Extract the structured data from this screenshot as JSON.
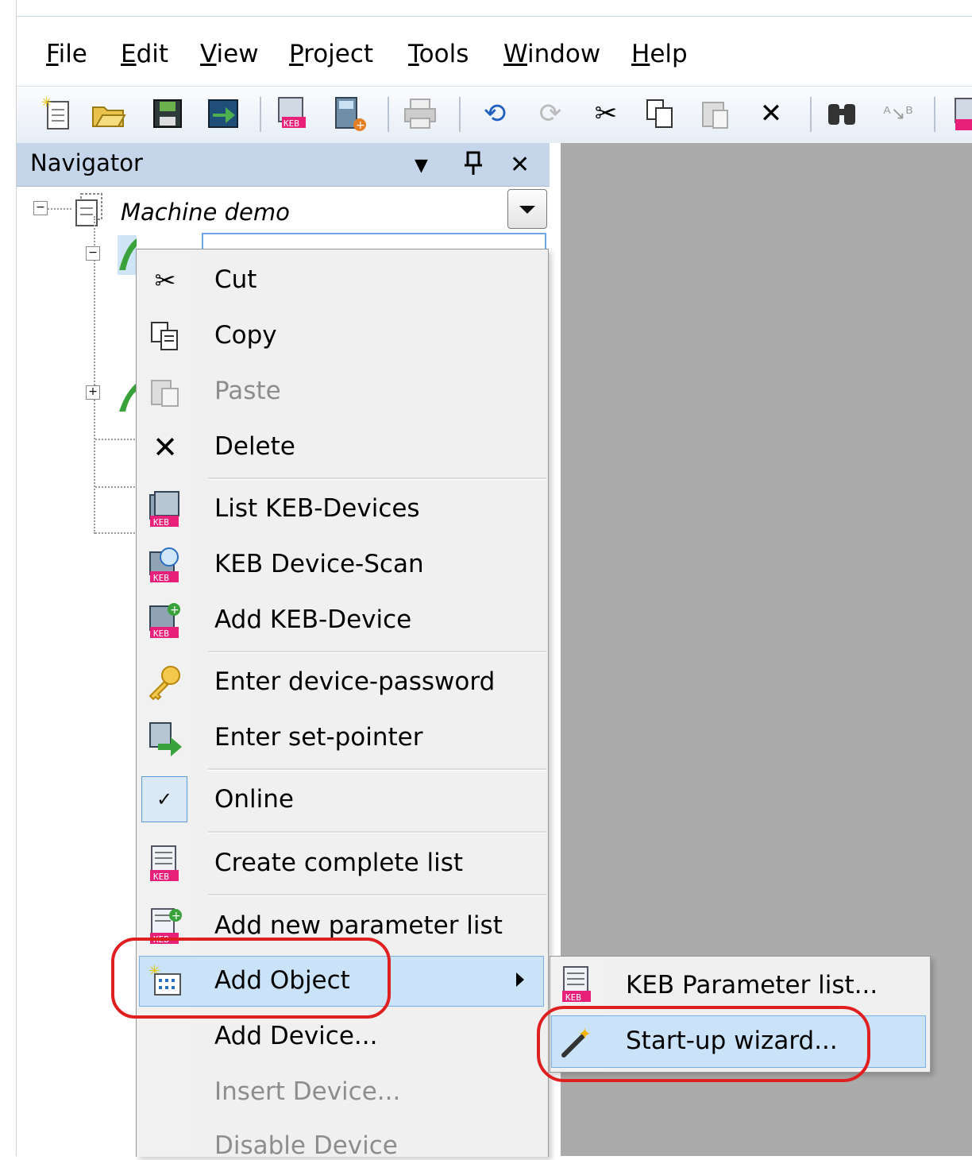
{
  "menubar": {
    "items": [
      {
        "label": "File",
        "u": "F"
      },
      {
        "label": "Edit",
        "u": "E"
      },
      {
        "label": "View",
        "u": "V"
      },
      {
        "label": "Project",
        "u": "P"
      },
      {
        "label": "Tools",
        "u": "T"
      },
      {
        "label": "Window",
        "u": "W"
      },
      {
        "label": "Help",
        "u": "H"
      }
    ]
  },
  "toolbar": {
    "icons": [
      "new-file-icon",
      "open-folder-icon",
      "save-icon",
      "import-icon",
      "keb-list-icon",
      "add-device-icon",
      "print-icon",
      "undo-icon",
      "redo-icon",
      "cut-icon",
      "copy-icon",
      "paste-icon",
      "delete-icon",
      "find-icon",
      "replace-icon",
      "keb-edit-icon"
    ]
  },
  "navigator": {
    "title": "Navigator",
    "buttons": {
      "dropdown": "▼",
      "pin": "个",
      "close": "✕"
    },
    "tree": {
      "root_label": "Machine demo"
    }
  },
  "context_menu": {
    "items": [
      {
        "label": "Cut",
        "icon": "scissors-icon",
        "disabled": false
      },
      {
        "label": "Copy",
        "icon": "copy-icon",
        "disabled": false
      },
      {
        "label": "Paste",
        "icon": "paste-icon",
        "disabled": true
      },
      {
        "label": "Delete",
        "icon": "delete-x-icon",
        "disabled": false
      },
      {
        "label": "List KEB-Devices",
        "icon": "keb-device-list-icon",
        "disabled": false
      },
      {
        "label": "KEB Device-Scan",
        "icon": "keb-scan-icon",
        "disabled": false
      },
      {
        "label": "Add KEB-Device",
        "icon": "keb-add-device-icon",
        "disabled": false
      },
      {
        "label": "Enter device-password",
        "icon": "key-icon",
        "disabled": false
      },
      {
        "label": "Enter set-pointer",
        "icon": "set-pointer-icon",
        "disabled": false
      },
      {
        "label": "Online",
        "icon": "check-icon",
        "disabled": false,
        "checked": true
      },
      {
        "label": "Create complete list",
        "icon": "keb-list-icon",
        "disabled": false
      },
      {
        "label": "Add new parameter list",
        "icon": "keb-add-list-icon",
        "disabled": false
      },
      {
        "label": "Add Object",
        "icon": "add-object-icon",
        "disabled": false,
        "highlighted": true,
        "has_submenu": true
      },
      {
        "label": "Add Device...",
        "icon": "",
        "disabled": false
      },
      {
        "label": "Insert Device...",
        "icon": "",
        "disabled": true
      },
      {
        "label": "Disable Device",
        "icon": "",
        "disabled": true
      }
    ]
  },
  "submenu": {
    "items": [
      {
        "label": "KEB Parameter list...",
        "icon": "keb-parameter-list-icon",
        "highlighted": false
      },
      {
        "label": "Start-up wizard...",
        "icon": "magic-wand-icon",
        "highlighted": true
      }
    ]
  },
  "colors": {
    "highlight": "#cbe3f9",
    "highlight_border": "#7aaee6",
    "annotation_red": "#e02020",
    "keb_badge": "#e8207a",
    "nav_header": "#c6d6ea",
    "workspace": "#ababab"
  }
}
